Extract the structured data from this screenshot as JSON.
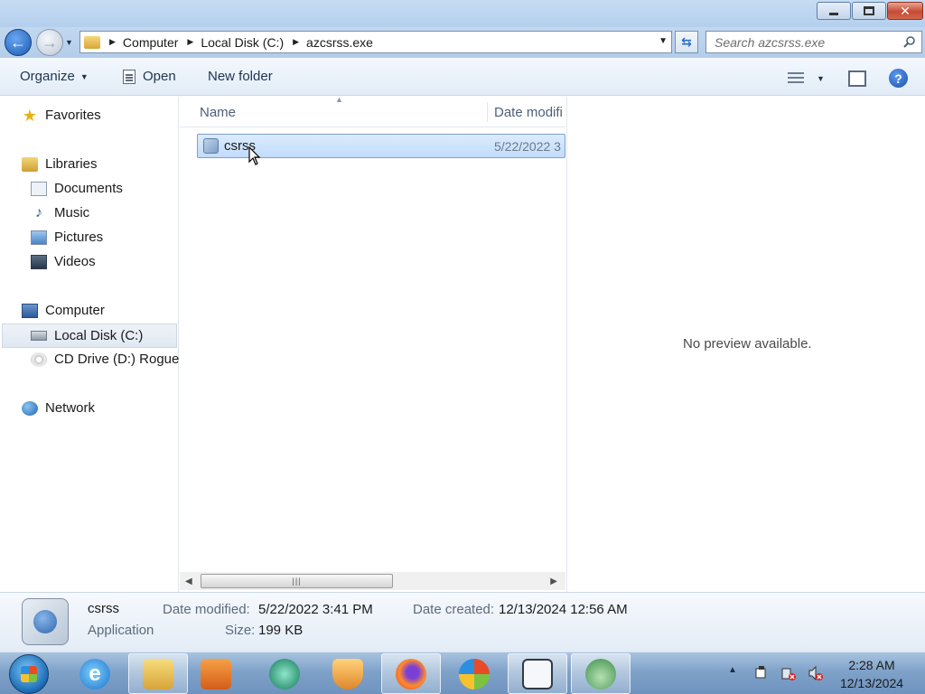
{
  "address": {
    "crumbs": [
      "Computer",
      "Local Disk (C:)",
      "azcsrss.exe"
    ],
    "search_placeholder": "Search azcsrss.exe"
  },
  "toolbar": {
    "organize_label": "Organize",
    "open_label": "Open",
    "new_folder_label": "New folder"
  },
  "nav": {
    "favorites": "Favorites",
    "libraries": "Libraries",
    "documents": "Documents",
    "music": "Music",
    "pictures": "Pictures",
    "videos": "Videos",
    "computer": "Computer",
    "local_disk": "Local Disk (C:)",
    "cd_drive": "CD Drive (D:) Rogue",
    "network": "Network"
  },
  "filelist": {
    "col_name": "Name",
    "col_date": "Date modifi",
    "files": [
      {
        "name": "csrss",
        "date": "5/22/2022 3"
      }
    ]
  },
  "preview": {
    "message": "No preview available."
  },
  "details": {
    "name": "csrss",
    "type": "Application",
    "date_modified_label": "Date modified:",
    "date_modified": "5/22/2022 3:41 PM",
    "date_created_label": "Date created:",
    "date_created": "12/13/2024 12:56 AM",
    "size_label": "Size:",
    "size": "199 KB"
  },
  "taskbar": {
    "time": "2:28 AM",
    "date": "12/13/2024",
    "apps": [
      "internet-explorer-icon",
      "file-explorer-icon",
      "media-player-icon",
      "chat-app-icon",
      "shield-app-icon",
      "firefox-icon",
      "windows-orb-app-icon",
      "window-manager-icon",
      "installer-icon"
    ]
  },
  "colors": {
    "selection": "#c1dcfc",
    "titlebar": "#b4cfee",
    "close": "#c74a33"
  }
}
